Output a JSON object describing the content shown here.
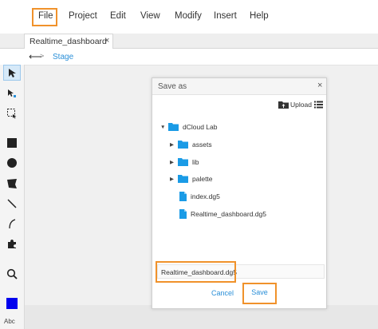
{
  "menu": {
    "items": [
      "File",
      "Project",
      "Edit",
      "View",
      "Modify",
      "Insert",
      "Help"
    ]
  },
  "tab": {
    "label": "Realtime_dashboard",
    "close": "×"
  },
  "breadcrumb": {
    "back": "⟵",
    "forward": ">",
    "current": "Stage"
  },
  "status": {
    "text": "Abc"
  },
  "colors": {
    "accent": "#2a8fd8",
    "highlight": "#f0922b",
    "fill_swatch": "#0000ee",
    "folder": "#1a9be6"
  },
  "dialog": {
    "title": "Save as",
    "close": "×",
    "upload_label": "Upload",
    "tree": [
      {
        "label": "dCloud Lab",
        "type": "folder",
        "expanded": true
      },
      {
        "label": "assets",
        "type": "folder",
        "expanded": false
      },
      {
        "label": "lib",
        "type": "folder",
        "expanded": false
      },
      {
        "label": "palette",
        "type": "folder",
        "expanded": false
      },
      {
        "label": "index.dg5",
        "type": "file"
      },
      {
        "label": "Realtime_dashboard.dg5",
        "type": "file"
      }
    ],
    "filename_value": "Realtime_dashboard.dg5",
    "cancel_label": "Cancel",
    "save_label": "Save"
  }
}
